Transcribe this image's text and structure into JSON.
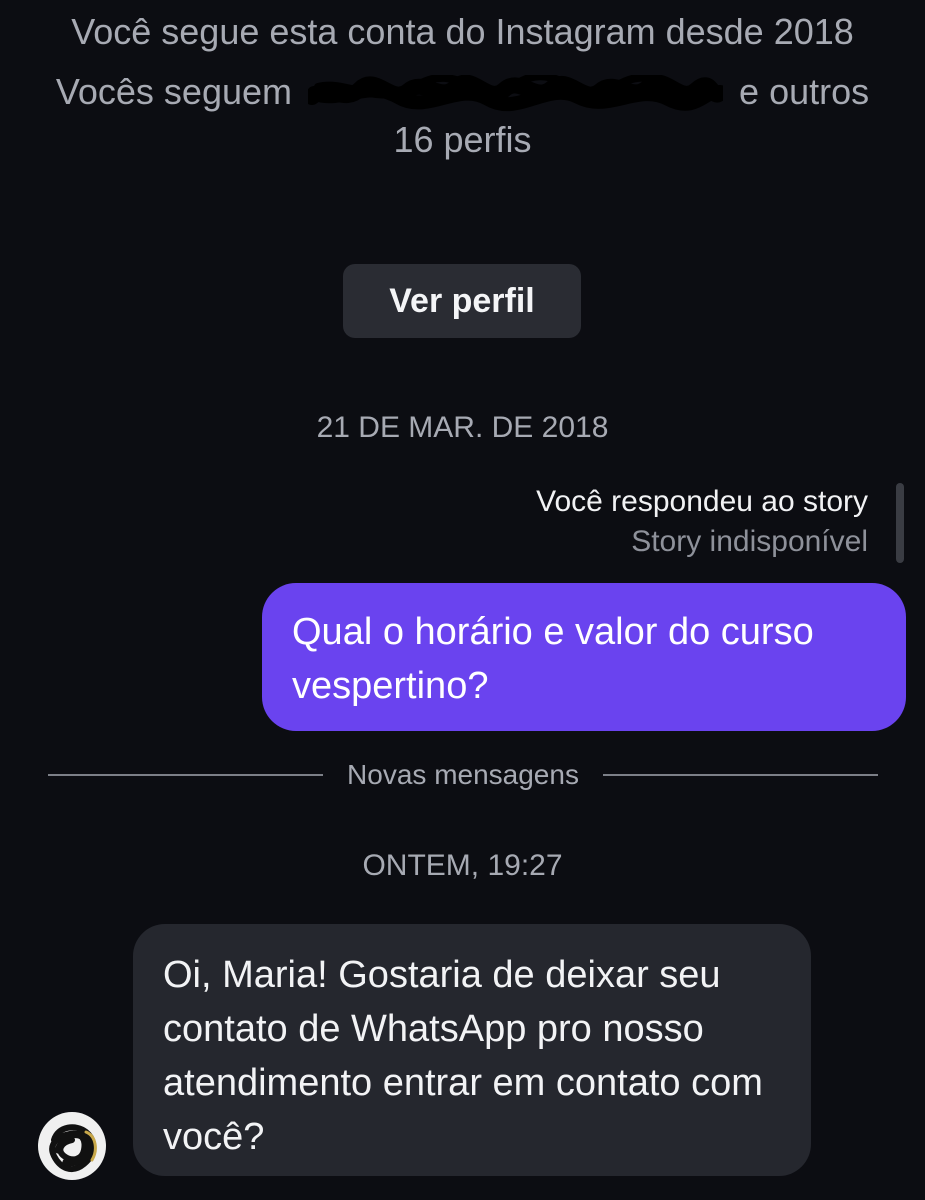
{
  "profile_header": {
    "follow_since": "Você segue esta conta do Instagram desde 2018",
    "mutual_prefix": "Vocês seguem",
    "mutual_suffix": "e outros",
    "mutual_count": "16 perfis",
    "view_profile_label": "Ver perfil"
  },
  "thread": {
    "date_stamp_1": "21 DE MAR. DE 2018",
    "story_reply": {
      "title": "Você respondeu ao story",
      "status": "Story indisponível"
    },
    "sent_message": "Qual o horário e valor do curso vespertino?",
    "divider_label": "Novas mensagens",
    "date_stamp_2": "ONTEM, 19:27",
    "received_message": "Oi, Maria! Gostaria de deixar seu contato de WhatsApp pro nosso atendimento entrar em contato com você?"
  },
  "colors": {
    "background": "#0c0d12",
    "sent_bubble": "#6a43ef",
    "received_bubble": "#25272e",
    "button_bg": "#2a2c33",
    "muted_text": "#a7aab3"
  },
  "icons": {
    "avatar": "scribbled-avatar",
    "redaction": "scribble-redaction"
  }
}
